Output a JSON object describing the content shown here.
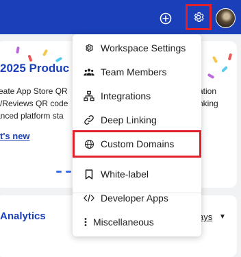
{
  "header": {
    "add_icon": "plus-circle-icon",
    "settings_icon": "gear-icon",
    "brand_color": "#1b3fb8",
    "highlight_color": "#e0202a"
  },
  "announcement": {
    "title": "2025 Produc",
    "lines": [
      "reate App Store QR",
      "s/Reviews QR code",
      "anced platform sta"
    ],
    "right_lines": [
      "ation",
      "nking"
    ],
    "link": "t's new"
  },
  "analytics": {
    "title": "Analytics",
    "range": "ays"
  },
  "menu": {
    "items": [
      {
        "label": "Workspace Settings",
        "icon": "gear-icon"
      },
      {
        "label": "Team Members",
        "icon": "users-icon"
      },
      {
        "label": "Integrations",
        "icon": "sitemap-icon"
      },
      {
        "label": "Deep Linking",
        "icon": "link-icon"
      },
      {
        "label": "Custom Domains",
        "icon": "globe-icon"
      },
      {
        "label": "White-label",
        "icon": "bookmark-icon"
      },
      {
        "label": "Developer Apps",
        "icon": "code-icon"
      },
      {
        "label": "Miscellaneous",
        "icon": "ellipsis-vertical-icon"
      }
    ]
  }
}
